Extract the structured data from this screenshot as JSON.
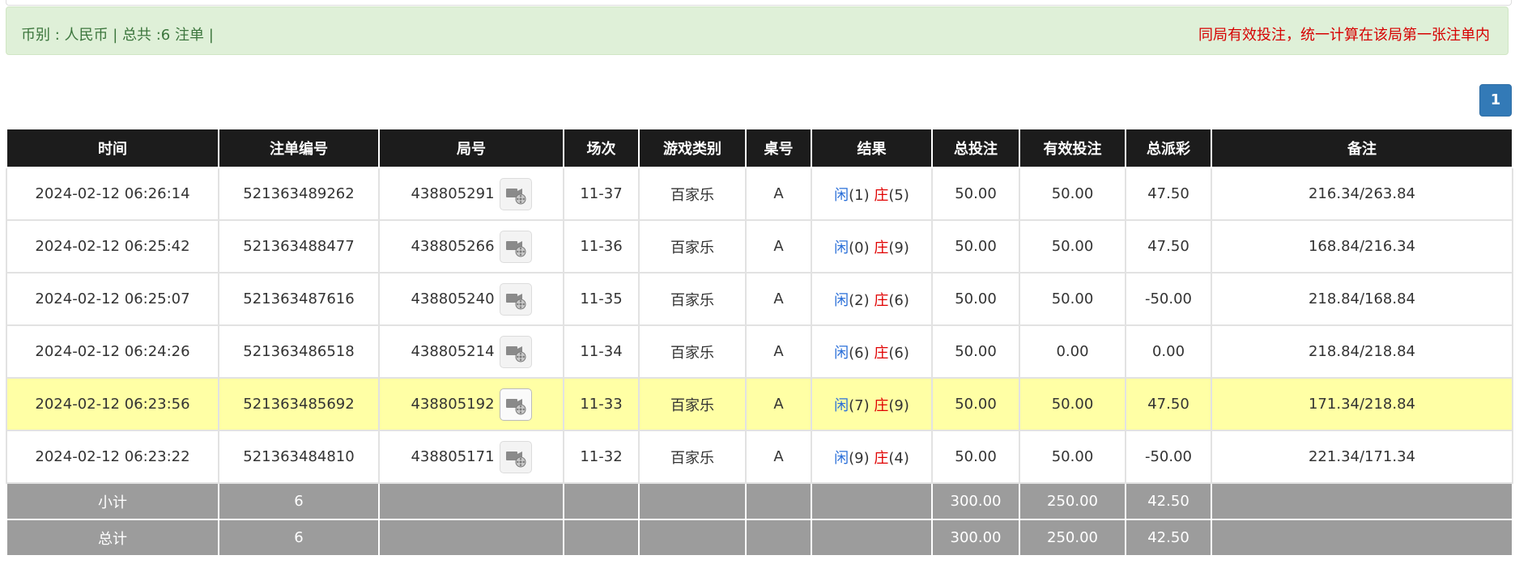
{
  "summary": {
    "left_text": "币别 : 人民币 | 总共 :6 注单 |",
    "right_text": "同局有效投注，统一计算在该局第一张注单内"
  },
  "pagination": {
    "current_page": "1"
  },
  "table": {
    "headers": [
      "时间",
      "注单编号",
      "局号",
      "场次",
      "游戏类别",
      "桌号",
      "结果",
      "总投注",
      "有效投注",
      "总派彩",
      "备注"
    ],
    "rows": [
      {
        "time": "2024-02-12 06:26:14",
        "bet_id": "521363489262",
        "round_id": "438805291",
        "session": "11-37",
        "game": "百家乐",
        "table": "A",
        "player_label": "闲",
        "player_score": "(1)",
        "banker_label": "庄",
        "banker_score": "(5)",
        "total_bet": "50.00",
        "valid_bet": "50.00",
        "payout": "47.50",
        "payout_negative": false,
        "note": "216.34/263.84",
        "highlight": false
      },
      {
        "time": "2024-02-12 06:25:42",
        "bet_id": "521363488477",
        "round_id": "438805266",
        "session": "11-36",
        "game": "百家乐",
        "table": "A",
        "player_label": "闲",
        "player_score": "(0)",
        "banker_label": "庄",
        "banker_score": "(9)",
        "total_bet": "50.00",
        "valid_bet": "50.00",
        "payout": "47.50",
        "payout_negative": false,
        "note": "168.84/216.34",
        "highlight": false
      },
      {
        "time": "2024-02-12 06:25:07",
        "bet_id": "521363487616",
        "round_id": "438805240",
        "session": "11-35",
        "game": "百家乐",
        "table": "A",
        "player_label": "闲",
        "player_score": "(2)",
        "banker_label": "庄",
        "banker_score": "(6)",
        "total_bet": "50.00",
        "valid_bet": "50.00",
        "payout": "-50.00",
        "payout_negative": true,
        "note": "218.84/168.84",
        "highlight": false
      },
      {
        "time": "2024-02-12 06:24:26",
        "bet_id": "521363486518",
        "round_id": "438805214",
        "session": "11-34",
        "game": "百家乐",
        "table": "A",
        "player_label": "闲",
        "player_score": "(6)",
        "banker_label": "庄",
        "banker_score": "(6)",
        "total_bet": "50.00",
        "valid_bet": "0.00",
        "payout": "0.00",
        "payout_negative": false,
        "note": "218.84/218.84",
        "highlight": false
      },
      {
        "time": "2024-02-12 06:23:56",
        "bet_id": "521363485692",
        "round_id": "438805192",
        "session": "11-33",
        "game": "百家乐",
        "table": "A",
        "player_label": "闲",
        "player_score": "(7)",
        "banker_label": "庄",
        "banker_score": "(9)",
        "total_bet": "50.00",
        "valid_bet": "50.00",
        "payout": "47.50",
        "payout_negative": false,
        "note": "171.34/218.84",
        "highlight": true
      },
      {
        "time": "2024-02-12 06:23:22",
        "bet_id": "521363484810",
        "round_id": "438805171",
        "session": "11-32",
        "game": "百家乐",
        "table": "A",
        "player_label": "闲",
        "player_score": "(9)",
        "banker_label": "庄",
        "banker_score": "(4)",
        "total_bet": "50.00",
        "valid_bet": "50.00",
        "payout": "-50.00",
        "payout_negative": true,
        "note": "221.34/171.34",
        "highlight": false
      }
    ],
    "subtotal": {
      "label": "小计",
      "count": "6",
      "total_bet": "300.00",
      "valid_bet": "250.00",
      "payout": "42.50"
    },
    "total": {
      "label": "总计",
      "count": "6",
      "total_bet": "300.00",
      "valid_bet": "250.00",
      "payout": "42.50"
    }
  },
  "icons": {
    "replay": "video-replay-icon"
  },
  "colors": {
    "header_bg": "#1c1c1c",
    "highlight_row": "#ffffa5",
    "summary_bar": "#dff0d8",
    "player": "#2a6fd8",
    "banker": "#e00000",
    "page_button": "#337ab7"
  }
}
